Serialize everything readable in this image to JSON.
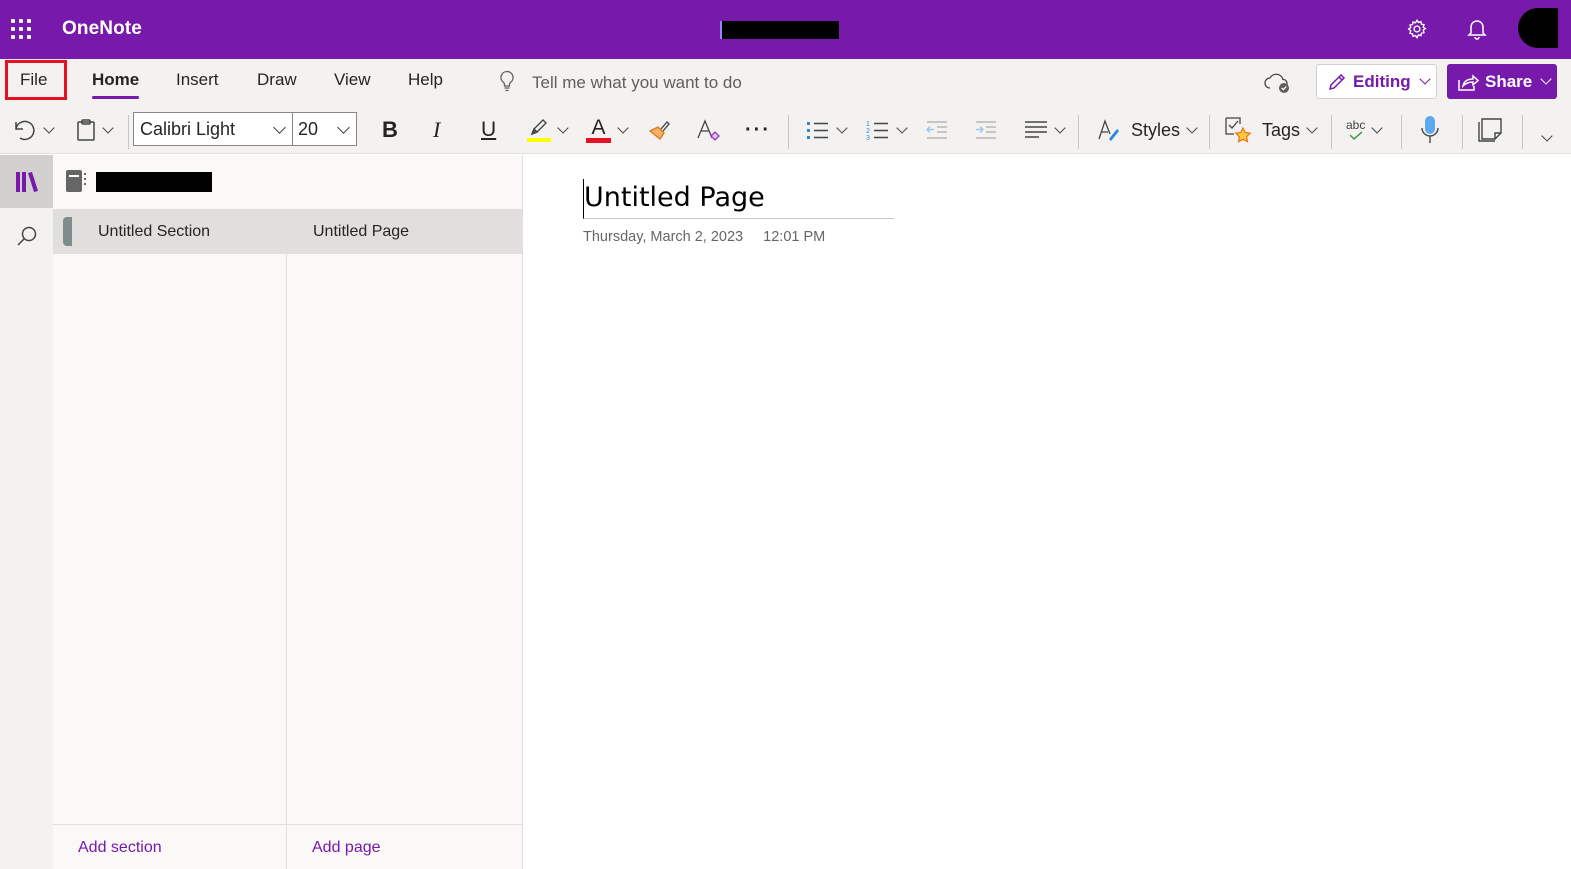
{
  "titlebar": {
    "app_name": "OneNote",
    "doc_title": "[redacted]",
    "icons": [
      "app-launcher-icon",
      "settings-icon",
      "notifications-icon",
      "account-avatar"
    ]
  },
  "ribbon": {
    "tabs": [
      {
        "label": "File",
        "active": false,
        "highlighted": true
      },
      {
        "label": "Home",
        "active": true
      },
      {
        "label": "Insert",
        "active": false
      },
      {
        "label": "Draw",
        "active": false
      },
      {
        "label": "View",
        "active": false
      },
      {
        "label": "Help",
        "active": false
      }
    ],
    "tell_me_placeholder": "Tell me what you want to do",
    "editing_label": "Editing",
    "share_label": "Share",
    "commands": {
      "font_name": "Calibri Light",
      "font_size": "20",
      "styles_label": "Styles",
      "tags_label": "Tags",
      "spelling_glyph": "abc"
    },
    "colors": {
      "highlight": "#ffff00",
      "font_color": "#e81123"
    }
  },
  "colors": {
    "brand": "#7719aa",
    "file_highlight_box": "#e81123",
    "section_color": "#7f8c8d"
  },
  "nav": {
    "notebook_name": "[redacted]",
    "sections": [
      {
        "label": "Untitled Section",
        "selected": true
      }
    ],
    "pages": [
      {
        "label": "Untitled Page",
        "selected": true
      }
    ],
    "add_section_label": "Add section",
    "add_page_label": "Add page"
  },
  "page": {
    "title": "Untitled Page",
    "date": "Thursday, March 2, 2023",
    "time": "12:01 PM"
  }
}
